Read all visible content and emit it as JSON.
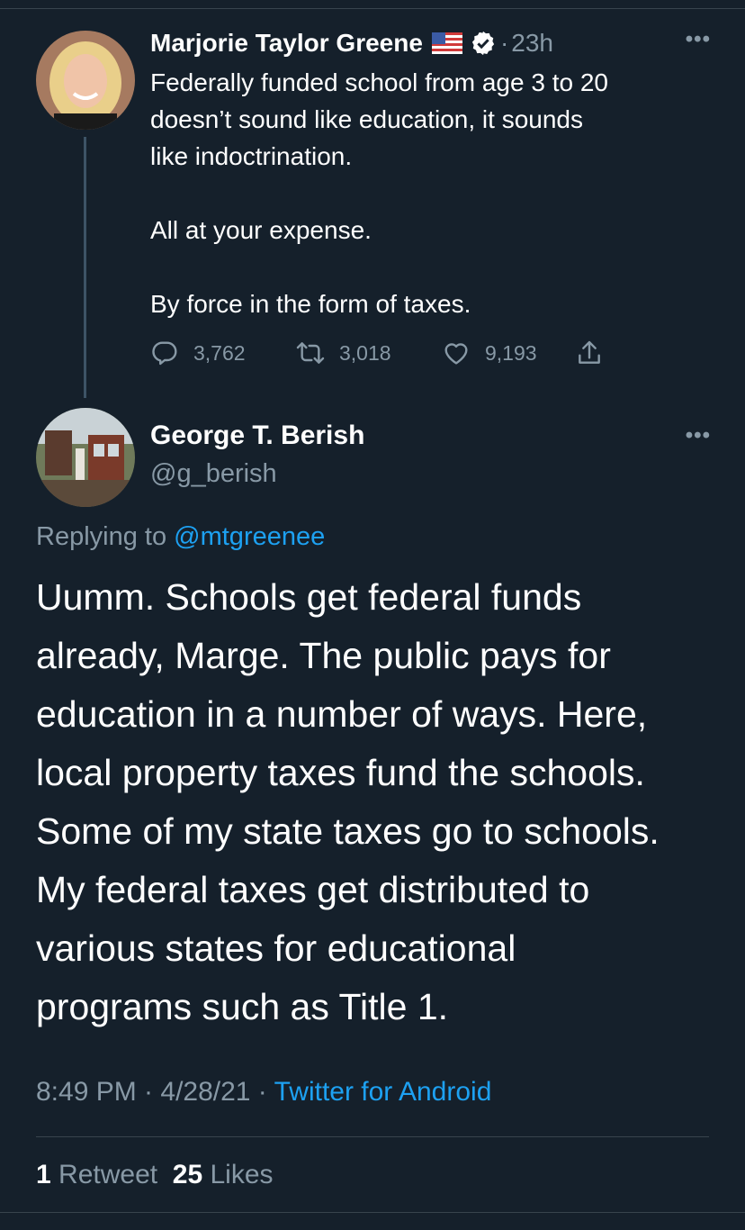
{
  "tweet": {
    "author_name": "Marjorie Taylor Greene",
    "time": "23h",
    "text_lines": [
      "Federally funded school from age 3 to 20",
      "doesn’t sound like education, it sounds",
      "like indoctrination."
    ],
    "text_p2": "All at your expense.",
    "text_p3": "By force in the form of taxes.",
    "replies": "3,762",
    "retweets": "3,018",
    "likes": "9,193",
    "icons": [
      "us-flag-icon",
      "verified-badge-icon",
      "more-options-icon",
      "reply-icon",
      "retweet-icon",
      "like-icon",
      "share-icon"
    ]
  },
  "reply": {
    "author_name": "George T. Berish",
    "handle": "@g_berish",
    "replying_prefix": "Replying to",
    "replying_to": "@mtgreenee",
    "text_lines": [
      "Uumm. Schools get federal funds",
      "already, Marge. The public pays for",
      "education in a number of ways. Here,",
      "local property taxes fund the schools.",
      "Some of my state taxes go to schools.",
      "My federal taxes get distributed to",
      "various states for educational",
      "programs such as Title 1."
    ],
    "timestamp": "8:49 PM · 4/28/21 · ",
    "source": "Twitter for Android",
    "retweet_count": "1",
    "retweet_label": "Retweet",
    "like_count": "25",
    "like_label": "Likes"
  },
  "colors": {
    "background": "#15202b",
    "text": "#ffffff",
    "muted": "#8899a6",
    "accent": "#1da1f2",
    "divider": "#38444d"
  }
}
